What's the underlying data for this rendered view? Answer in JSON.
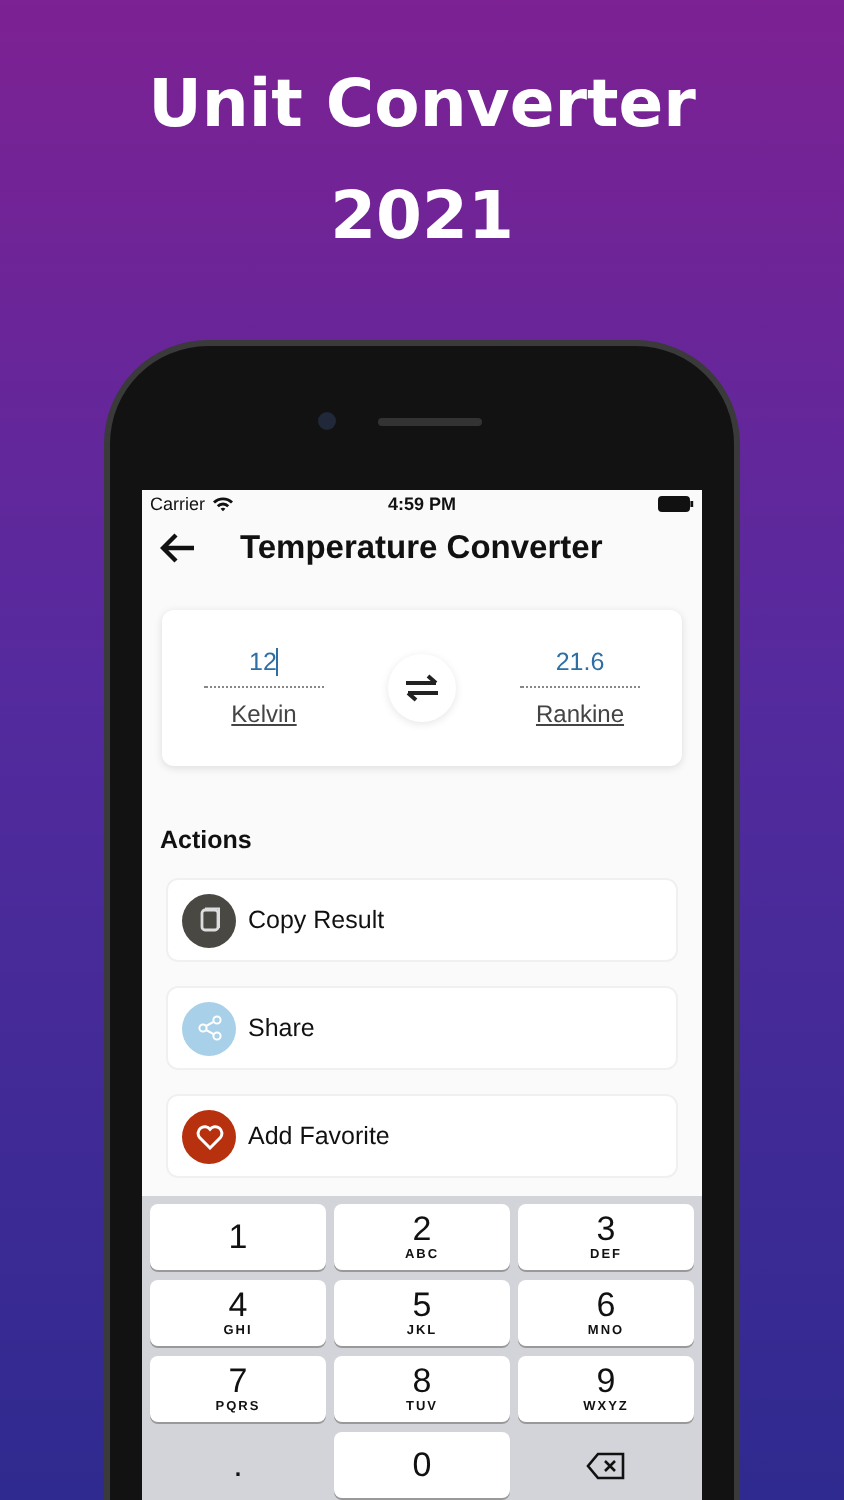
{
  "headline": "Unit Converter 2021",
  "status_bar": {
    "carrier": "Carrier",
    "time": "4:59 PM"
  },
  "nav": {
    "title": "Temperature Converter"
  },
  "converter": {
    "from": {
      "value": "12",
      "unit": "Kelvin",
      "focused": true
    },
    "to": {
      "value": "21.6",
      "unit": "Rankine",
      "focused": false
    }
  },
  "actions": {
    "title": "Actions",
    "items": [
      {
        "kind": "copy",
        "label": "Copy Result",
        "color": "#4a4843"
      },
      {
        "kind": "share",
        "label": "Share",
        "color": "#a8d0e8"
      },
      {
        "kind": "favorite",
        "label": "Add Favorite",
        "color": "#b8310f"
      }
    ]
  },
  "keypad": [
    {
      "kind": "digit",
      "digit": "1"
    },
    {
      "kind": "digit",
      "digit": "2",
      "letters": "ABC"
    },
    {
      "kind": "digit",
      "digit": "3",
      "letters": "DEF"
    },
    {
      "kind": "digit",
      "digit": "4",
      "letters": "GHI"
    },
    {
      "kind": "digit",
      "digit": "5",
      "letters": "JKL"
    },
    {
      "kind": "digit",
      "digit": "6",
      "letters": "MNO"
    },
    {
      "kind": "digit",
      "digit": "7",
      "letters": "PQRS"
    },
    {
      "kind": "digit",
      "digit": "8",
      "letters": "TUV"
    },
    {
      "kind": "digit",
      "digit": "9",
      "letters": "WXYZ"
    },
    {
      "kind": "dot",
      "digit": "."
    },
    {
      "kind": "digit",
      "digit": "0"
    },
    {
      "kind": "delete"
    }
  ]
}
